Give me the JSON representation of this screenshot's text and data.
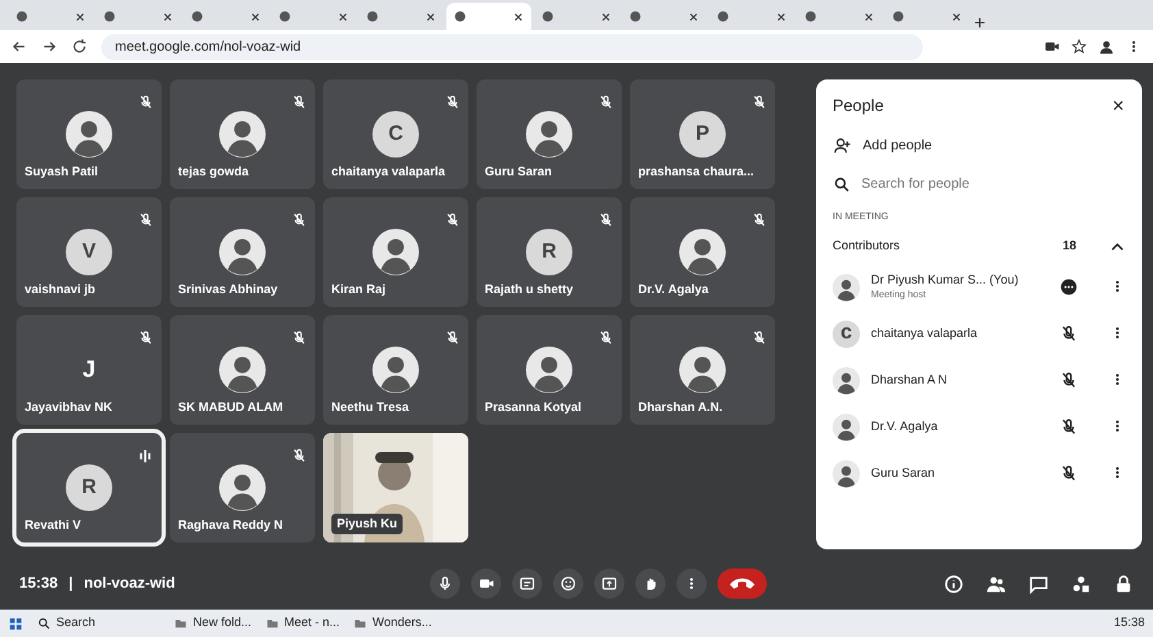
{
  "browser": {
    "tabs": [
      {
        "selected": false
      },
      {
        "selected": false
      },
      {
        "selected": false
      },
      {
        "selected": false
      },
      {
        "selected": false
      },
      {
        "selected": true
      },
      {
        "selected": false
      },
      {
        "selected": false
      },
      {
        "selected": false
      },
      {
        "selected": false
      },
      {
        "selected": false
      }
    ],
    "address": "meet.google.com/nol-voaz-wid"
  },
  "tiles": [
    {
      "name": "Suyash Patil",
      "muted": true,
      "speaking": false
    },
    {
      "name": "tejas gowda",
      "muted": true,
      "speaking": false
    },
    {
      "name": "chaitanya valaparla",
      "kind": "letter",
      "initial": "C",
      "muted": true,
      "speaking": false
    },
    {
      "name": "Guru Saran",
      "muted": true,
      "speaking": false
    },
    {
      "name": "prashansa chaura...",
      "kind": "letter",
      "initial": "P",
      "muted": true,
      "speaking": false
    },
    {
      "name": "vaishnavi jb",
      "kind": "letter",
      "initial": "V",
      "muted": true,
      "speaking": false
    },
    {
      "name": "Srinivas Abhinay",
      "muted": true,
      "speaking": false
    },
    {
      "name": "Kiran Raj",
      "muted": true,
      "speaking": false
    },
    {
      "name": "Rajath u shetty",
      "kind": "letter",
      "initial": "R",
      "muted": true,
      "speaking": false
    },
    {
      "name": "Dr.V. Agalya",
      "muted": true,
      "speaking": false
    },
    {
      "name": "Jayavibhav NK",
      "kind": "bare",
      "initial": "J",
      "muted": true,
      "speaking": false
    },
    {
      "name": "SK MABUD ALAM",
      "muted": true,
      "speaking": false
    },
    {
      "name": "Neethu Tresa",
      "muted": true,
      "speaking": false
    },
    {
      "name": "Prasanna Kotyal",
      "muted": true,
      "speaking": false
    },
    {
      "name": "Dharshan A.N.",
      "muted": true,
      "speaking": false
    },
    {
      "name": "Revathi V",
      "kind": "letter",
      "initial": "R",
      "muted": false,
      "speaking": true
    },
    {
      "name": "Raghava Reddy N",
      "muted": true,
      "speaking": false
    },
    {
      "name": "Piyush Ku",
      "kind": "video",
      "muted": false,
      "speaking": false
    }
  ],
  "meeting": {
    "time": "15:38",
    "separator": "|",
    "code": "nol-voaz-wid"
  },
  "people": {
    "title": "People",
    "close": "×",
    "add": "Add people",
    "search_placeholder": "Search for people",
    "section": "IN MEETING",
    "group": "Contributors",
    "count": "18",
    "expanded": true,
    "rows": [
      {
        "name": "Dr Piyush Kumar S... (You)",
        "subtitle": "Meeting host",
        "muted": false
      },
      {
        "name": "chaitanya valaparla",
        "kind": "letter",
        "initial": "c",
        "muted": true
      },
      {
        "name": "Dharshan A N",
        "muted": true
      },
      {
        "name": "Dr.V. Agalya",
        "muted": true
      },
      {
        "name": "Guru Saran",
        "muted": true
      }
    ]
  },
  "taskbar": {
    "search": "Search",
    "items": [
      "New fold...",
      "Meet - n...",
      "Wonders..."
    ],
    "clock": "15:38"
  }
}
